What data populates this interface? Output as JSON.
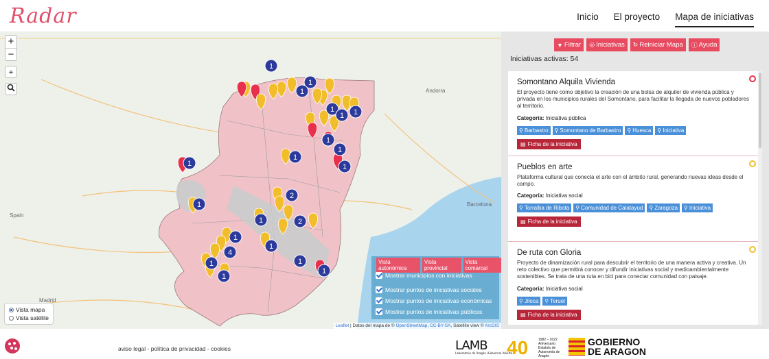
{
  "header": {
    "logo_text": "Radar",
    "nav": [
      {
        "label": "Inicio"
      },
      {
        "label": "El proyecto"
      },
      {
        "label": "Mapa de iniciativas",
        "active": true
      }
    ]
  },
  "map": {
    "zoom_in": "+",
    "zoom_out": "−",
    "locate_icon": "crosshair-icon",
    "search_icon": "magnifier-icon",
    "layer_options": [
      {
        "label": "Vista mapa",
        "checked": true
      },
      {
        "label": "Vista satélite",
        "checked": false
      }
    ],
    "view_tabs": [
      "Vista autonómica",
      "Vista provincial",
      "Vista comarcal"
    ],
    "checkboxes": [
      {
        "label": "Mostrar municipios con iniciativas",
        "checked": true
      },
      {
        "label": "Mostrar puntos de iniciativas sociales",
        "checked": true
      },
      {
        "label": "Mostrar puntos de iniciativas económicas",
        "checked": true
      },
      {
        "label": "Mostrar puntos de iniciativas públicas",
        "checked": true
      }
    ],
    "place_labels": [
      "Spain",
      "Andorra",
      "Barcelona",
      "Madrid"
    ],
    "attribution": {
      "leaflet": "Leaflet",
      "text1": " | Datos del mapa de © ",
      "osm": "OpenStreetMap",
      "sep": ", ",
      "ccbysa": "CC-BY-SA",
      "text2": ", Satellite view © ",
      "arcgis": "ArcGIS"
    },
    "colors": {
      "social": "#f2bd2a",
      "economic": "#e8304c",
      "cluster": "#2c3a9c",
      "region": "#f0c2c8"
    }
  },
  "panel": {
    "buttons": [
      {
        "icon": "filter-icon",
        "label": "Filtrar"
      },
      {
        "icon": "target-icon",
        "label": "Iniciativas"
      },
      {
        "icon": "refresh-icon",
        "label": "Reiniciar Mapa"
      },
      {
        "icon": "info-icon",
        "label": "Ayuda"
      }
    ],
    "count_text": "Iniciativas activas: 54",
    "cards": [
      {
        "title": "Somontano Alquila Vivienda",
        "description": "El proyecto tiene como objetivo la creación de una bolsa de alquiler de vivienda pública y privada en los municipios rurales del Somontano, para facilitar la llegada de nuevos pobladores al territorio.",
        "category_label": "Categoría:",
        "category": "Iniciativa pública",
        "tags": [
          "Barbastro",
          "Somontano de Barbastro",
          "Huesca",
          "Iniciativa"
        ],
        "button": "Ficha de la iniciativa",
        "badge_color": "#e8304c"
      },
      {
        "title": "Pueblos en arte",
        "description": "Plataforma cultural que conecta el arte con el ámbito rural, generando nuevas ideas desde el campo.",
        "category_label": "Categoría:",
        "category": "Iniciativa social",
        "tags": [
          "Torralba de Ribota",
          "Comunidad de Calatayud",
          "Zaragoza",
          "Iniciativa"
        ],
        "button": "Ficha de la iniciativa",
        "badge_color": "#f2bd2a"
      },
      {
        "title": "De ruta con Gloria",
        "description": "Proyecto de dinamización rural para descubrir el territorio de una manera activa y creativa. Un reto colectivo que permitirá conocer y difundir iniciativas social y medioambientalmente sostenibles. Se trata de una ruta en bici para conectar comunidad con paisaje.",
        "category_label": "Categoría:",
        "category": "Iniciativa social",
        "tags": [
          "Jiloca",
          "Teruel"
        ],
        "button": "Ficha de la iniciativa",
        "badge_color": "#f2bd2a"
      }
    ]
  },
  "footer": {
    "links": "aviso legal - política de privacidad - cookies",
    "logo_lamb": "LAMB",
    "logo_lamb_sub": "Laboratorio de Aragón (Gobierno) Abierto",
    "logo_40": "40",
    "logo_40_lines": [
      "1982 – 2022",
      "Aniversario",
      "Estatuto de",
      "Autonomía de",
      "Aragón"
    ],
    "logo_gobierno_1": "GOBIERNO",
    "logo_gobierno_2": "DE ARAGON"
  }
}
